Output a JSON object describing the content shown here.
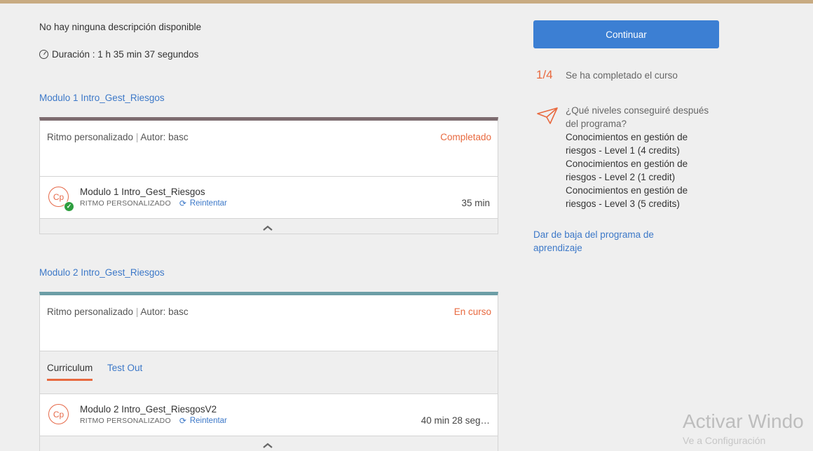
{
  "course": {
    "description": "No hay ninguna descripción disponible",
    "duration": "Duración : 1 h 35 min 37 segundos"
  },
  "modules": [
    {
      "title": "Modulo 1 Intro_Gest_Riesgos",
      "meta_pace": "Ritmo personalizado",
      "meta_author": "Autor: basc",
      "status": "Completado",
      "item": {
        "icon_text": "Cp",
        "title": "Modulo 1 Intro_Gest_Riesgos",
        "type": "RITMO PERSONALIZADO",
        "action": "Reintentar",
        "duration": "35 min",
        "completed": true
      }
    },
    {
      "title": "Modulo 2 Intro_Gest_Riesgos",
      "meta_pace": "Ritmo personalizado",
      "meta_author": "Autor: basc",
      "status": "En curso",
      "tabs": [
        "Curriculum",
        "Test Out"
      ],
      "item": {
        "icon_text": "Cp",
        "title": "Modulo 2 Intro_Gest_RiesgosV2",
        "type": "RITMO PERSONALIZADO",
        "action": "Reintentar",
        "duration": "40 min 28 seg…",
        "completed": false
      }
    }
  ],
  "sidebar": {
    "continue_label": "Continuar",
    "progress_fraction": "1/4",
    "progress_text": "Se ha completado el curso",
    "levels_question": "¿Qué niveles conseguiré después del programa?",
    "levels": [
      "Conocimientos en gestión de riesgos - Level 1 (4 credits)",
      "Conocimientos en gestión de riesgos - Level 2 (1 credit)",
      "Conocimientos en gestión de riesgos - Level 3 (5 credits)"
    ],
    "unenroll_label": "Dar de baja del programa de aprendizaje"
  },
  "watermark": {
    "line1": "Activar Windo",
    "line2": "Ve a Configuración"
  },
  "colors": {
    "accent_blue": "#3c7fd3",
    "accent_orange": "#e8693f",
    "completed_green": "#2e9e3f",
    "top_bar": "#c8ab82",
    "module1_bar": "#7d6b6f",
    "module2_bar": "#6c9ea6"
  },
  "icons": {
    "duration": "clock-icon",
    "retry": "refresh-icon",
    "collapse": "chevron-up-icon",
    "levels": "paper-plane-icon",
    "completed": "checkmark-icon"
  }
}
